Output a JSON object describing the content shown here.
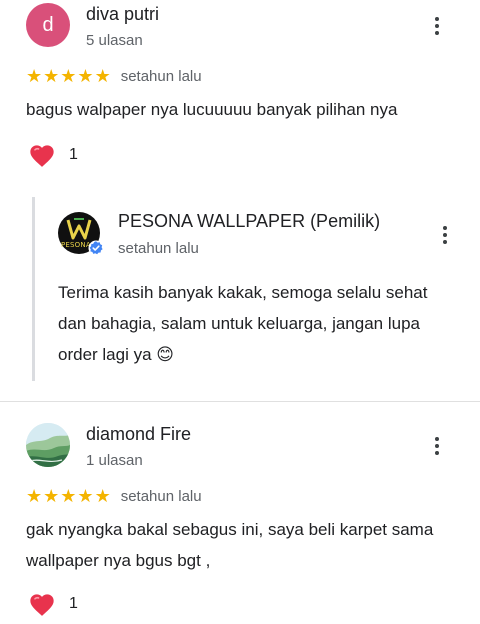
{
  "reviews": [
    {
      "avatar_letter": "d",
      "name": "diva putri",
      "review_count": "5 ulasan",
      "rating": 5,
      "time": "setahun lalu",
      "text": "bagus walpaper nya lucuuuuu banyak pilihan nya",
      "likes": "1",
      "reply": {
        "owner_name": "PESONA WALLPAPER (Pemilik)",
        "logo_text": "PESONA",
        "time": "setahun lalu",
        "text": "Terima kasih banyak kakak, semoga selalu sehat dan bahagia, salam untuk keluarga, jangan lupa order lagi ya 😊"
      }
    },
    {
      "name": "diamond Fire",
      "review_count": "1 ulasan",
      "rating": 5,
      "time": "setahun lalu",
      "text": "gak nyangka bakal sebagus ini, saya  beli karpet sama wallpaper nya bgus bgt ,",
      "likes": "1"
    }
  ],
  "icons": {
    "more": "more-vert-icon",
    "star": "star-icon",
    "heart": "heart-icon",
    "verified": "verified-badge-icon"
  },
  "colors": {
    "star": "#f4b400",
    "heart": "#e8334d",
    "avatar": "#d9507a",
    "verified": "#4285f4",
    "reply_border": "#dadce0"
  }
}
